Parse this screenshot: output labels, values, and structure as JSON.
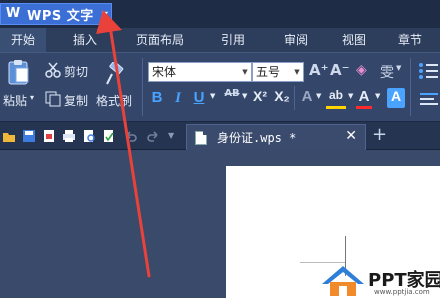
{
  "app": {
    "logo": "W",
    "title": "WPS 文字",
    "menu_caret": "▼"
  },
  "tabs": [
    {
      "label": "开始",
      "active": true
    },
    {
      "label": "插入"
    },
    {
      "label": "页面布局"
    },
    {
      "label": "引用"
    },
    {
      "label": "审阅"
    },
    {
      "label": "视图"
    },
    {
      "label": "章节"
    }
  ],
  "ribbon": {
    "paste": "粘贴",
    "paste_caret": "▾",
    "cut": "剪切",
    "copy": "复制",
    "format_painter": "格式刷",
    "font_name": "宋体",
    "font_size": "五号",
    "grow": "A⁺",
    "shrink": "A⁻",
    "clear": "◈",
    "phonetic": "雯",
    "bold": "B",
    "italic": "I",
    "underline": "U",
    "strike": "AB",
    "superscript": "X²",
    "subscript": "X₂",
    "text_effect": "A",
    "highlight": "ab",
    "font_color": "A",
    "char_shading": "A"
  },
  "quickbar": {
    "icons": [
      "open-icon",
      "save-icon",
      "pdf-icon",
      "print-icon",
      "preview-icon",
      "spell-icon",
      "undo-icon",
      "redo-icon",
      "dropdown-icon"
    ]
  },
  "document": {
    "name": "身份证.wps *",
    "close": "✕",
    "new_tab": "+"
  },
  "watermark": {
    "text": "PPT家园",
    "url": "www.pptjia.com"
  },
  "colors": {
    "accent": "#3b6fd6",
    "ribbon": "#34466a",
    "arrow": "#e8423a",
    "highlight": "#ffd400",
    "font_color": "#ff2b2b"
  }
}
